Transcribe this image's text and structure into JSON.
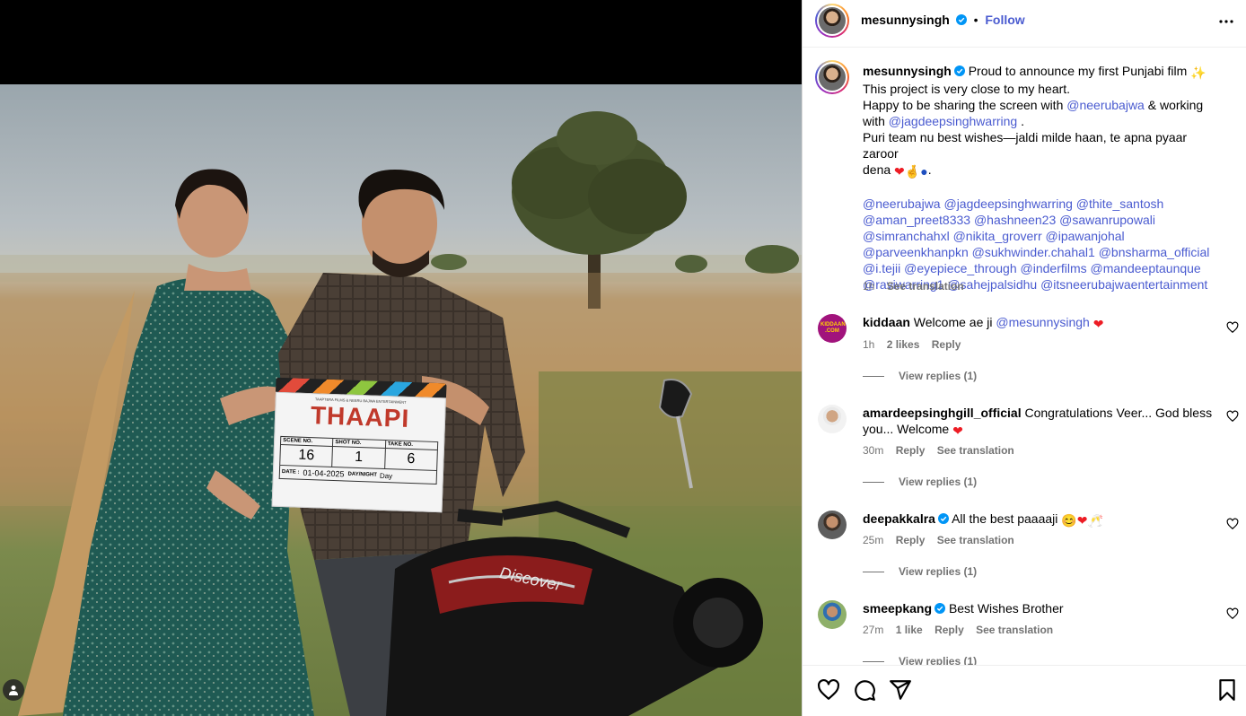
{
  "post": {
    "username": "mesunnysingh",
    "follow_label": "Follow",
    "dot": "•"
  },
  "caption": {
    "username": "mesunnysingh",
    "line1": "Proud to announce my first Punjabi film",
    "line2": "This project is very close to my heart.",
    "line3_a": "Happy to be sharing the screen with",
    "line3_mention": "@neerubajwa",
    "line3_b": "& working",
    "line4_a": "with",
    "line4_mention": "@jagdeepsinghwarring",
    "line4_b": ".",
    "line5": "Puri team nu best wishes—jaldi milde haan, te apna pyaar zaroor",
    "line6": "dena",
    "line6_end": ".",
    "tags": [
      "@neerubajwa @jagdeepsinghwarring @thite_santosh",
      "@aman_preet8333 @hashneen23 @sawanrupowali",
      "@simranchahxl @nikita_groverr @ipawanjohal",
      "@parveenkhanpkn @sukhwinder.chahal1 @bnsharma_official",
      "@i.tejii @eyepiece_through @inderfilms @mandeeptaunque",
      "@raviwarring1 @sahejpalsidhu @itsneerubajwaentertainment"
    ],
    "time": "1h",
    "see_translation": "See translation"
  },
  "comments": [
    {
      "username": "kiddaan",
      "text_a": "Welcome ae ji",
      "mention": "@mesunnysingh",
      "time": "1h",
      "likes": "2 likes",
      "reply": "Reply",
      "view_replies": "View replies (1)",
      "avatar_text": "KIDDAAN .COM"
    },
    {
      "username": "amardeepsinghgill_official",
      "text_a": "Congratulations Veer... God bless",
      "text_b": "you... Welcome",
      "time": "30m",
      "reply": "Reply",
      "see_translation": "See translation",
      "view_replies": "View replies (1)"
    },
    {
      "username": "deepakkalra",
      "text_a": "All the best paaaaji",
      "time": "25m",
      "reply": "Reply",
      "see_translation": "See translation",
      "view_replies": "View replies (1)"
    },
    {
      "username": "smeepkang",
      "text_a": "Best Wishes Brother",
      "time": "27m",
      "likes": "1 like",
      "reply": "Reply",
      "see_translation": "See translation",
      "view_replies": "View replies (1)"
    }
  ],
  "clapboard": {
    "production": "TAAPTERA FILMS & NEERU BAJWA ENTERTAINMENT",
    "title": "THAAPI",
    "scene_label": "SCENE NO.",
    "shot_label": "SHOT NO.",
    "take_label": "TAKE NO.",
    "scene": "16",
    "shot": "1",
    "take": "6",
    "date_label": "DATE :",
    "date": "01-04-2025",
    "daynight_label": "DAY/NIGHT",
    "daynight": "Day"
  },
  "bike": {
    "badge": "Discover"
  },
  "colors": {
    "accent": "#4a5bd0",
    "verified": "#0095f6",
    "muted": "#737373",
    "heart_red": "#ed1c24"
  },
  "icons": [
    "more-icon",
    "like-icon",
    "comment-icon",
    "share-icon",
    "save-icon",
    "heart-icon",
    "verified-icon",
    "user-tag-icon"
  ]
}
